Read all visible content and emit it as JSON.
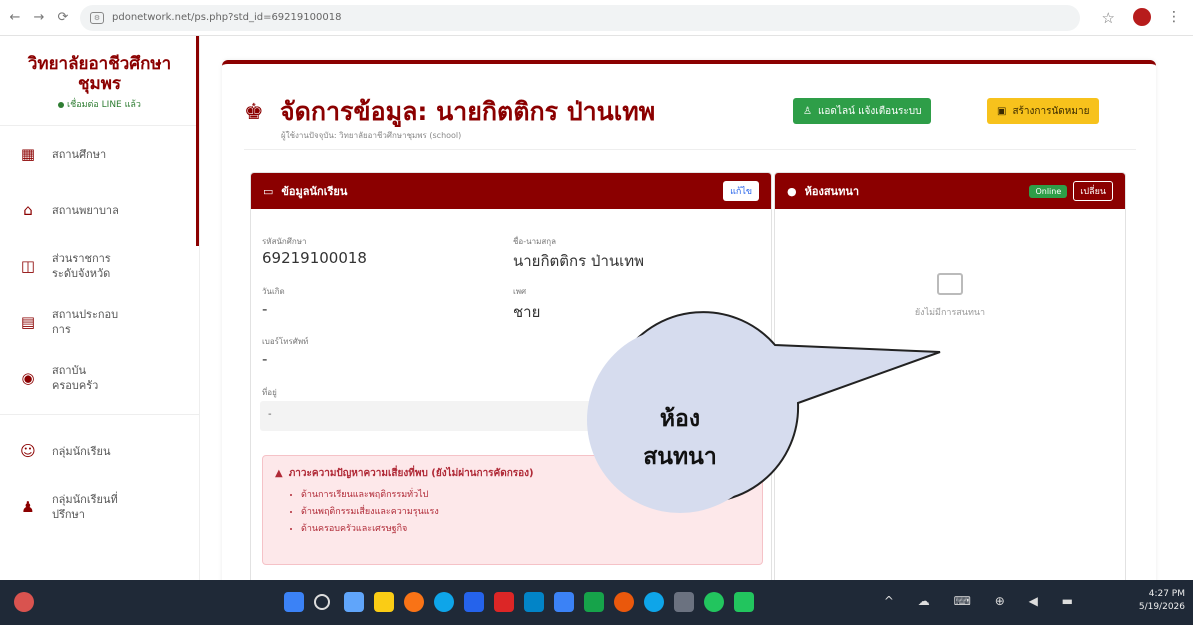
{
  "browser": {
    "url": "pdonetwork.net/ps.php?std_id=69219100018",
    "back_glyph": "←",
    "forward_glyph": "→",
    "reload_glyph": "⟳",
    "star_glyph": "☆",
    "menu_glyph": "⋮"
  },
  "sidebar": {
    "brand_line1": "วิทยาลัยอาชีวศึกษา",
    "brand_line2": "ชุมพร",
    "status": "เชื่อมต่อ LINE แล้ว",
    "items": [
      {
        "label": "สถานศึกษา",
        "icon": "building-icon",
        "glyph": "▦"
      },
      {
        "label": "สถานพยาบาล",
        "icon": "hospital-icon",
        "glyph": "⌂"
      },
      {
        "label": "ส่วนราชการ ระดับจังหวัด",
        "icon": "government-icon",
        "glyph": "◫"
      },
      {
        "label": "สถานประกอบ การ",
        "icon": "business-icon",
        "glyph": "▤"
      },
      {
        "label": "สถาบัน ครอบครัว",
        "icon": "family-icon",
        "glyph": "◉"
      },
      {
        "label": "กลุ่มนักเรียน",
        "icon": "group-icon",
        "glyph": "☺"
      },
      {
        "label": "กลุ่มนักเรียนที่ ปรึกษา",
        "icon": "advisee-group-icon",
        "glyph": "♟"
      }
    ]
  },
  "header": {
    "title": "จัดการข้อมูล: นายกิตติกร ป่านเทพ",
    "subtitle": "ผู้ใช้งานปัจจุบัน: วิทยาลัยอาชีวศึกษาชุมพร (school)",
    "line_button": "แอดไลน์ แจ้งเตือนระบบ",
    "appointment_button": "สร้างการนัดหมาย"
  },
  "student_card": {
    "title": "ข้อมูลนักเรียน",
    "edit_label": "แก้ไข",
    "fields": {
      "student_id_label": "รหัสนักศึกษา",
      "student_id": "69219100018",
      "name_label": "ชื่อ-นามสกุล",
      "name": "นายกิตติกร ป่านเทพ",
      "birthday_label": "วันเกิด",
      "birthday": "-",
      "gender_label": "เพศ",
      "gender": "ชาย",
      "phone_label": "เบอร์โทรศัพท์",
      "phone": "-",
      "address_label": "ที่อยู่",
      "address": "-"
    },
    "risk_title": "ภาวะความปัญหาความเสี่ยงที่พบ (ยังไม่ผ่านการคัดกรอง)",
    "risk_items": [
      "ด้านการเรียนและพฤติกรรมทั่วไป",
      "ด้านพฤติกรรมเสี่ยงและความรุนแรง",
      "ด้านครอบครัวและเศรษฐกิจ"
    ]
  },
  "chat_card": {
    "title": "ห้องสนทนา",
    "online_badge": "Online",
    "switch_label": "เปลี่ยน",
    "empty_text": "ยังไม่มีการสนทนา"
  },
  "callout": {
    "line1": "ห้อง",
    "line2": "สนทนา",
    "fill": "#d6dcee",
    "stroke": "#222222"
  },
  "taskbar": {
    "time": "4:27 PM",
    "date": "5/19/2026",
    "tray": "^ ☁ ⌨ ⊕ ◀ ▬"
  },
  "colors": {
    "brand": "#8b0000",
    "green": "#2e9e48",
    "yellow": "#f7c21c"
  }
}
